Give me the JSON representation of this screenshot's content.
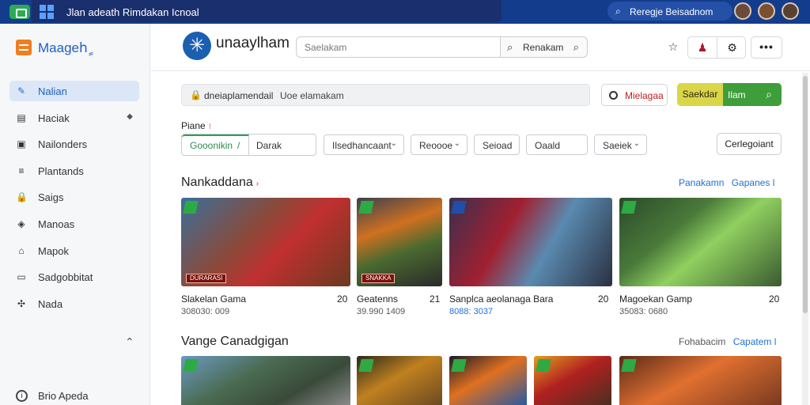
{
  "os_bar": {
    "title": "Jlan adeath Rimdakan Icnoal",
    "search": "Reregje Beisadnom"
  },
  "sidebar": {
    "brand": "Maagehٍ",
    "items": [
      {
        "label": "Nalian",
        "icon": "edit-circle-icon",
        "glyph": "✎",
        "active": true
      },
      {
        "label": "Haciak",
        "icon": "inbox-icon",
        "glyph": "▤",
        "arrow": "◆"
      },
      {
        "label": "Nailonders",
        "icon": "image-icon",
        "glyph": "▣"
      },
      {
        "label": "Plantands",
        "icon": "list-icon",
        "glyph": "≡"
      },
      {
        "label": "Saigs",
        "icon": "lock-icon",
        "glyph": "🔒"
      },
      {
        "label": "Manoas",
        "icon": "shield-icon",
        "glyph": "◈"
      },
      {
        "label": "Mapok",
        "icon": "home-icon",
        "glyph": "⌂"
      },
      {
        "label": "Sadgobbitat",
        "icon": "card-icon",
        "glyph": "▭"
      },
      {
        "label": "Nada",
        "icon": "cluster-icon",
        "glyph": "✣"
      }
    ],
    "collapse_glyph": "⌃",
    "footer": {
      "label": "Brio Apeda",
      "glyph": "i"
    }
  },
  "header": {
    "site_name": "unaaylham",
    "search_placeholder": "Saelakam",
    "search_button": "Renakam",
    "star_glyph": "☆",
    "user_glyph": "♟",
    "settings_glyph": "⚙",
    "more_glyph": "•••"
  },
  "filters": {
    "lock_glyph": "🔒",
    "path": "dneiaplamendail",
    "value": "Uoe elamakam",
    "radio_label": "Mielagaa",
    "cta_left": "Saekdar",
    "cta_right": "Ilam",
    "field_label": "Piane",
    "required_mark": "⁝",
    "combo_active": "Gooonikin",
    "combo_slash": "/",
    "combo_second": "Darak",
    "dropdowns": [
      {
        "label": "Ilsedhancaant",
        "chevron": true
      },
      {
        "label": "Reoooe",
        "chevron": true
      },
      {
        "label": "Seioad",
        "chevron": false
      },
      {
        "label": "Oaald",
        "chevron": false
      },
      {
        "label": "Saeiek",
        "chevron": true
      }
    ],
    "categories_button": "Cerlegoiant"
  },
  "section1": {
    "title": "Nankaddana",
    "mark": "›",
    "link_a": "Panakamn",
    "link_b": "Gapanes l",
    "cards": [
      {
        "name": "Slakelan Gama",
        "num": "20",
        "sub": "308030: 009",
        "banner": "DURARASI",
        "sub_blue": false
      },
      {
        "name": "Geatenns",
        "num": "21",
        "sub": "39.990 1409",
        "banner": "SNAKKA",
        "sub_blue": false
      },
      {
        "name": "Sanplca aeolanaga Bara",
        "num": "20",
        "sub": "8088: 3037",
        "banner": "",
        "sub_blue": true
      },
      {
        "name": "Magoekan Gamp",
        "num": "20",
        "sub": "35083: 0680",
        "banner": "",
        "sub_blue": false
      }
    ]
  },
  "section2": {
    "title": "Vange Canadgigan",
    "link_a": "Fohabacim",
    "link_b": "Capatem l"
  }
}
